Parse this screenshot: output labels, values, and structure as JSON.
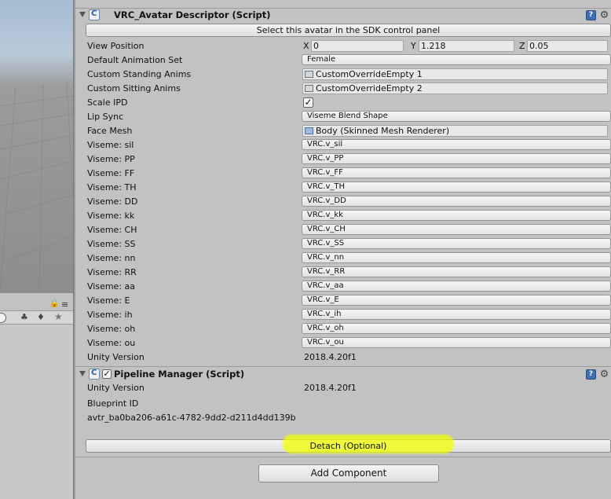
{
  "left_panel": {
    "lock_icon": "lock-icon",
    "menu_icon": "menu-icon",
    "toolbar_icons": [
      "search-circle-icon",
      "filter-icon",
      "tag-icon",
      "star-icon"
    ]
  },
  "vrc_avatar": {
    "title": "VRC_Avatar Descriptor (Script)",
    "select_button": "Select this avatar in the SDK control panel",
    "view_position": {
      "label": "View Position",
      "x_label": "X",
      "x": "0",
      "y_label": "Y",
      "y": "1.218",
      "z_label": "Z",
      "z": "0.05"
    },
    "default_animation_set": {
      "label": "Default Animation Set",
      "value": "Female"
    },
    "custom_standing_anims": {
      "label": "Custom Standing Anims",
      "value": "CustomOverrideEmpty 1"
    },
    "custom_sitting_anims": {
      "label": "Custom Sitting Anims",
      "value": "CustomOverrideEmpty 2"
    },
    "scale_ipd": {
      "label": "Scale IPD",
      "checked": true,
      "check": "✓"
    },
    "lip_sync": {
      "label": "Lip Sync",
      "value": "Viseme Blend Shape"
    },
    "face_mesh": {
      "label": "Face Mesh",
      "value": "Body (Skinned Mesh Renderer)"
    },
    "visemes": [
      {
        "label": "Viseme: sil",
        "value": "VRC.v_sil"
      },
      {
        "label": "Viseme: PP",
        "value": "VRC.v_PP"
      },
      {
        "label": "Viseme: FF",
        "value": "VRC.v_FF"
      },
      {
        "label": "Viseme: TH",
        "value": "VRC.v_TH"
      },
      {
        "label": "Viseme: DD",
        "value": "VRC.v_DD"
      },
      {
        "label": "Viseme: kk",
        "value": "VRC.v_kk"
      },
      {
        "label": "Viseme: CH",
        "value": "VRC.v_CH"
      },
      {
        "label": "Viseme: SS",
        "value": "VRC.v_SS"
      },
      {
        "label": "Viseme: nn",
        "value": "VRC.v_nn"
      },
      {
        "label": "Viseme: RR",
        "value": "VRC.v_RR"
      },
      {
        "label": "Viseme: aa",
        "value": "VRC.v_aa"
      },
      {
        "label": "Viseme: E",
        "value": "VRC.v_E"
      },
      {
        "label": "Viseme: ih",
        "value": "VRC.v_ih"
      },
      {
        "label": "Viseme: oh",
        "value": "VRC.v_oh"
      },
      {
        "label": "Viseme: ou",
        "value": "VRC.v_ou"
      }
    ],
    "unity_version": {
      "label": "Unity Version",
      "value": "2018.4.20f1"
    }
  },
  "pipeline": {
    "title": "Pipeline Manager (Script)",
    "enabled": true,
    "check": "✓",
    "unity_version": {
      "label": "Unity Version",
      "value": "2018.4.20f1"
    },
    "blueprint_label": "Blueprint ID",
    "blueprint_id": "avtr_ba0ba206-a61c-4782-9dd2-d211d4dd139b",
    "detach_button": "Detach (Optional)"
  },
  "add_component_button": "Add Component",
  "header_icons": {
    "help": "?",
    "gear": "⚙"
  },
  "colors": {
    "highlight": "#f0ff00",
    "help_icon": "#3e6fb3"
  }
}
